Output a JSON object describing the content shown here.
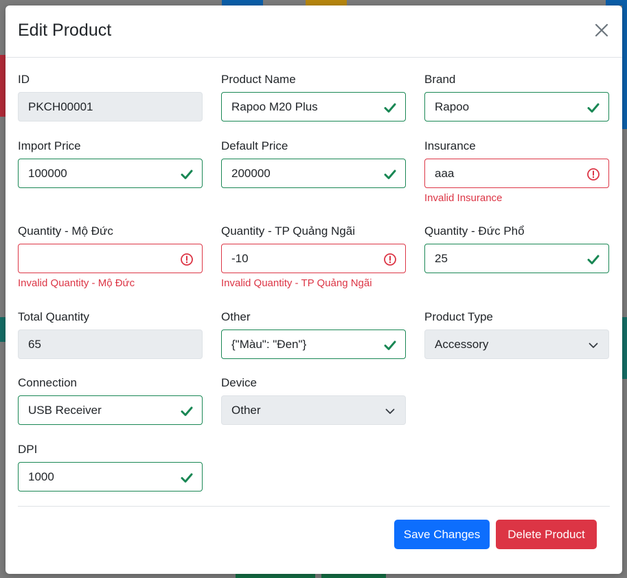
{
  "modal": {
    "title": "Edit Product",
    "close_icon": "close-icon"
  },
  "fields": {
    "id": {
      "label": "ID",
      "value": "PKCH00001",
      "state": "readonly"
    },
    "product_name": {
      "label": "Product Name",
      "value": "Rapoo M20 Plus",
      "state": "valid"
    },
    "brand": {
      "label": "Brand",
      "value": "Rapoo",
      "state": "valid"
    },
    "import_price": {
      "label": "Import Price",
      "value": "100000",
      "state": "valid"
    },
    "default_price": {
      "label": "Default Price",
      "value": "200000",
      "state": "valid"
    },
    "insurance": {
      "label": "Insurance",
      "value": "aaa",
      "state": "invalid",
      "feedback": "Invalid Insurance"
    },
    "qty_mo_duc": {
      "label": "Quantity - Mộ Đức",
      "value": "",
      "state": "invalid",
      "feedback": "Invalid Quantity - Mộ Đức"
    },
    "qty_tp_quang_ngai": {
      "label": "Quantity - TP Quảng Ngãi",
      "value": "-10",
      "state": "invalid",
      "feedback": "Invalid Quantity - TP Quảng Ngãi"
    },
    "qty_duc_pho": {
      "label": "Quantity - Đức Phổ",
      "value": "25",
      "state": "valid"
    },
    "total_quantity": {
      "label": "Total Quantity",
      "value": "65",
      "state": "readonly"
    },
    "other": {
      "label": "Other",
      "value": "{\"Màu\": \"Đen\"}",
      "state": "valid"
    },
    "product_type": {
      "label": "Product Type",
      "value": "Accessory",
      "state": "select"
    },
    "connection": {
      "label": "Connection",
      "value": "USB Receiver",
      "state": "valid"
    },
    "device": {
      "label": "Device",
      "value": "Other",
      "state": "select"
    },
    "dpi": {
      "label": "DPI",
      "value": "1000",
      "state": "valid"
    }
  },
  "buttons": {
    "save_label": "Save Changes",
    "delete_label": "Delete Product"
  },
  "colors": {
    "valid": "#198754",
    "invalid": "#dc3545",
    "primary": "#0d6efd",
    "danger": "#dc3545"
  }
}
